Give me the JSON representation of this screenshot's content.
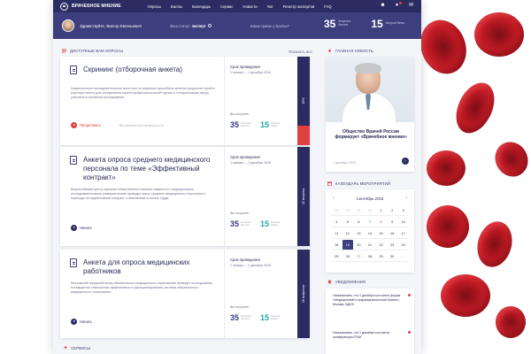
{
  "nav": {
    "brand": "ВРАЧЕБНОЕ МНЕНИЕ",
    "items": [
      "Опросы",
      "Баллы",
      "Календарь",
      "Сервис",
      "Новости",
      "Чат",
      "Регистр экспертов",
      "FAQ"
    ]
  },
  "profile": {
    "greeting": "Здравствуйте, Виктор Евгеньевич!",
    "status_label": "Ваш статус:",
    "status_value": "эксперт",
    "question": "Какие призы у Баллы?",
    "points1": {
      "value": "35",
      "label": "бонусных баллов"
    },
    "points2": {
      "value": "15",
      "label": "бонусов банка"
    }
  },
  "sections": {
    "surveys": "ДОСТУПНЫЕ ВАМ ОПРОСЫ",
    "show_all": "Показать все",
    "news": "ГЛАВНАЯ НОВОСТЬ",
    "calendar": "КАЛЕНДАРЬ МЕРОПРИЯТИЙ",
    "notifications": "УВЕДОМЛЕНИЯ",
    "services": "СЕРВИСЫ"
  },
  "cards": [
    {
      "title": "Скрининг (отборочная анкета)",
      "desc": "Национальное исследовательское агентство по изучению врачебного мнения предлагает пройти короткую анкету для определения вашей профессиональной группы и специализации перед участием в основном исследовании.",
      "action": "Продолжить",
      "hint": "Вы ответили на 3 вопроса из 10",
      "dates_label": "Срок проведения",
      "dates_value": "1 января — 1 декабря 2018",
      "earn_label": "Вы получите",
      "earn1": {
        "value": "35",
        "unit": "бонусных баллов"
      },
      "earn2": {
        "value": "15",
        "unit": "бонусов банка"
      },
      "tab": "15%"
    },
    {
      "title": "Анкета опроса среднего медицинского персонала по теме «Эффективный контракт»",
      "desc": "Всероссийский центр изучения общественного мнения совместно с медицинскими исследовательскими университетами проводит опрос среднего медицинского персонала о переходе на эффективный контракт и изменениях в оплате труда.",
      "action": "Начать",
      "hint": "",
      "dates_label": "Срок проведения",
      "dates_value": "1 января — 1 декабря 2018",
      "earn_label": "Вы получите",
      "earn1": {
        "value": "35",
        "unit": "бонусных баллов"
      },
      "earn2": {
        "value": "15",
        "unit": "бонусов банка"
      },
      "tab": "42 вопроса"
    },
    {
      "title": "Анкета для опроса медицинских работников",
      "desc": "Московский городской фонд обязательного медицинского страхования проводит исследование, посвящённое повышению эффективности функционирования системы обязательного медицинского страхования.",
      "action": "Начать",
      "hint": "",
      "dates_label": "Срок проведения",
      "dates_value": "1 января — 1 декабря 2018",
      "earn_label": "Вы получите",
      "earn1": {
        "value": "35",
        "unit": "бонусных баллов"
      },
      "earn2": {
        "value": "15",
        "unit": "бонусов банка"
      },
      "tab": "26 вопросов"
    }
  ],
  "news": {
    "title": "Общество Врачей России формирует «Врачебное мнение»",
    "date": "1 декабря 2018"
  },
  "calendar": {
    "month": "Сентябрь 2018",
    "days": [
      "28",
      "29",
      "30",
      "31",
      "1",
      "2",
      "3",
      "4",
      "5",
      "6",
      "7",
      "8",
      "9",
      "10",
      "11",
      "12",
      "13",
      "14",
      "15",
      "16",
      "17",
      "18",
      "19",
      "20",
      "21",
      "22",
      "23",
      "24",
      "25",
      "26",
      "27",
      "28",
      "29",
      "30",
      "1"
    ]
  },
  "notifications": [
    "Напоминаем, что 1 декабря состоится форум «Медицинский и фармацевтический бизнес», Москва, ВДНХ",
    "Напоминаем, что 1 декабря состоится конференция РОАГ"
  ]
}
